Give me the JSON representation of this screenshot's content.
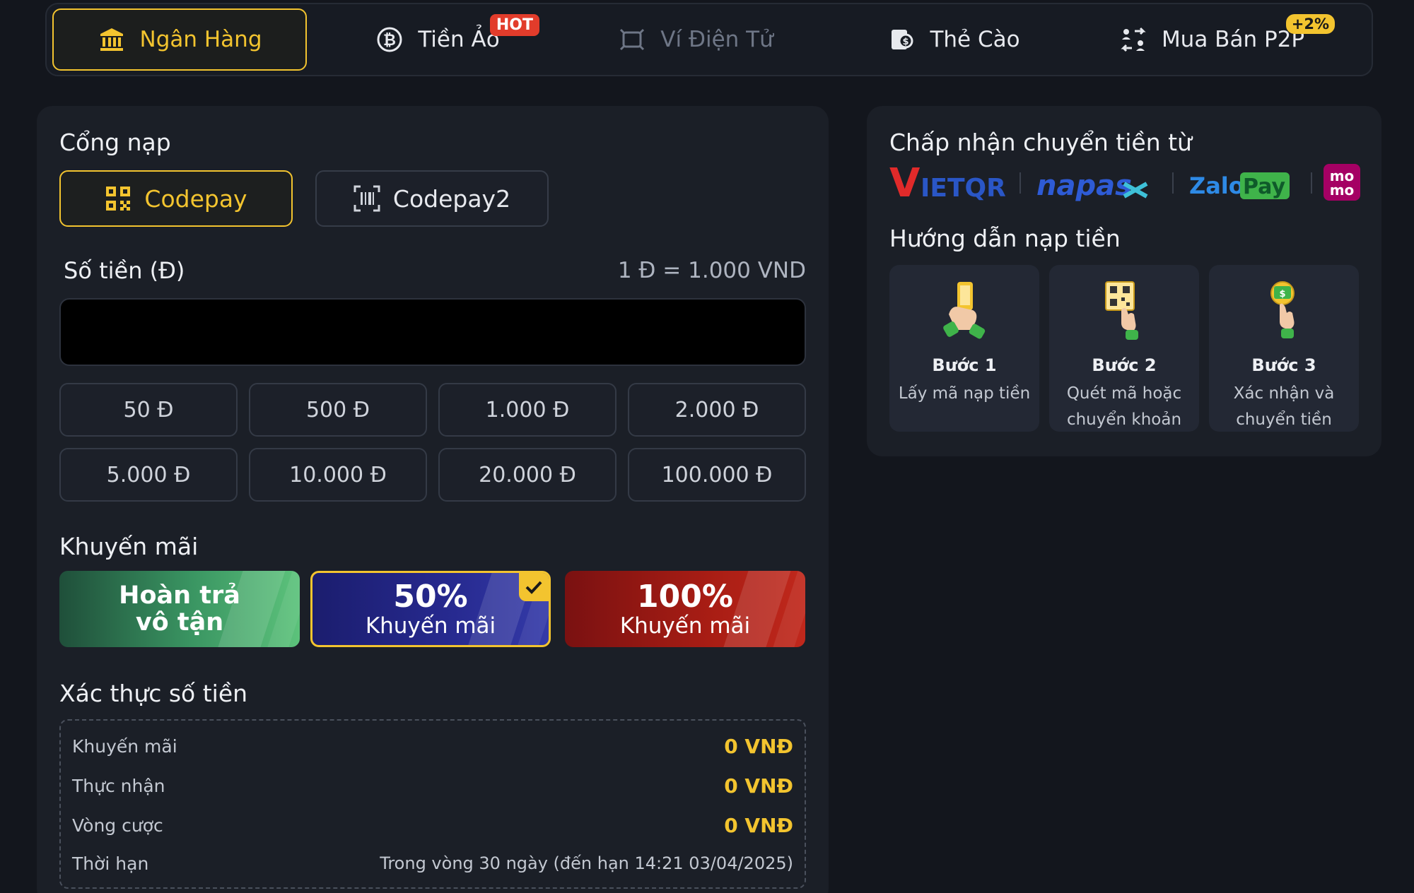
{
  "tabs": [
    {
      "label": "Ngân Hàng",
      "icon": "bank-icon",
      "state": "active"
    },
    {
      "label": "Tiền Ảo",
      "icon": "bitcoin-icon",
      "badge": "HOT"
    },
    {
      "label": "Ví Điện Tử",
      "icon": "wallet-icon",
      "state": "disabled"
    },
    {
      "label": "Thẻ Cào",
      "icon": "card-icon"
    },
    {
      "label": "Mua Bán P2P",
      "icon": "exchange-icon",
      "badge": "+2%"
    }
  ],
  "gateway": {
    "title": "Cổng nạp",
    "options": [
      {
        "label": "Codepay",
        "icon": "qr-icon",
        "active": true
      },
      {
        "label": "Codepay2",
        "icon": "barcode-scan-icon",
        "active": false
      }
    ]
  },
  "amount": {
    "label": "Số tiền (Đ)",
    "rate": "1 Đ = 1.000 VND",
    "value": "",
    "placeholder": "",
    "chips": [
      "50 Đ",
      "500 Đ",
      "1.000 Đ",
      "2.000 Đ",
      "5.000 Đ",
      "10.000 Đ",
      "20.000 Đ",
      "100.000 Đ"
    ]
  },
  "promotion": {
    "title": "Khuyến mãi",
    "options": [
      {
        "line1": "Hoàn trả",
        "line2": "vô tận",
        "color": "#3a9562"
      },
      {
        "line1": "50%",
        "line2": "Khuyến mãi",
        "color": "#272a90",
        "selected": true
      },
      {
        "line1": "100%",
        "line2": "Khuyến mãi",
        "color": "#a81d14"
      }
    ]
  },
  "verify": {
    "title": "Xác thực số tiền",
    "rows": [
      {
        "key": "Khuyến mãi",
        "value": "0 VNĐ"
      },
      {
        "key": "Thực nhận",
        "value": "0 VNĐ"
      },
      {
        "key": "Vòng cược",
        "value": "0 VNĐ"
      },
      {
        "key": "Thời hạn",
        "value": "Trong vòng 30 ngày (đến hạn 14:21 03/04/2025)"
      }
    ]
  },
  "accept": {
    "title": "Chấp nhận chuyển tiền từ",
    "logos": [
      "VietQR",
      "napas",
      "ZaloPay",
      "momo"
    ],
    "logo_text": {
      "vietqr_v": "V",
      "vietqr_rest": "IETQR",
      "napas": "napas",
      "zalo": "Zalo",
      "pay": "Pay",
      "momo_top": "mo",
      "momo_bottom": "mo"
    }
  },
  "guide": {
    "title": "Hướng dẫn nạp tiền",
    "steps": [
      {
        "title": "Bước 1",
        "desc": "Lấy mã nạp tiền"
      },
      {
        "title": "Bước 2",
        "desc": "Quét mã hoặc chuyển khoản"
      },
      {
        "title": "Bước 3",
        "desc": "Xác nhận và chuyển tiền"
      }
    ]
  },
  "colors": {
    "accent": "#f3c42f",
    "hot": "#e23c2b",
    "panel": "#1b1f27",
    "background": "#13161d"
  }
}
